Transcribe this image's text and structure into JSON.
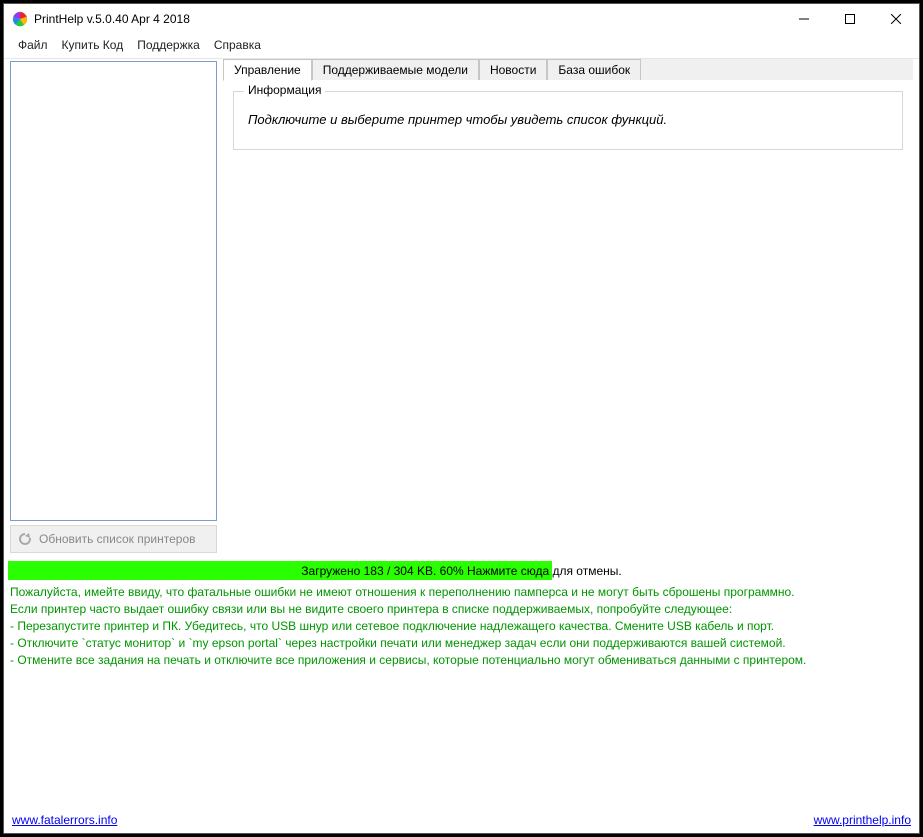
{
  "window": {
    "title": "PrintHelp v.5.0.40 Apr  4 2018"
  },
  "menu": {
    "file": "Файл",
    "buy": "Купить Код",
    "support": "Поддержка",
    "help": "Справка"
  },
  "left": {
    "refresh_label": "Обновить список принтеров"
  },
  "tabs": {
    "manage": "Управление",
    "models": "Поддерживаемые модели",
    "news": "Новости",
    "errors": "База ошибок"
  },
  "info": {
    "legend": "Информация",
    "text": "Подключите и выберите принтер чтобы увидеть список функций."
  },
  "progress": {
    "label": "Загружено 183 / 304 KB. 60% Нажмите сюда для отмены."
  },
  "log": {
    "l1": "Пожалуйста, имейте ввиду, что фатальные ошибки не имеют отношения к переполнению памперса и не могут быть сброшены программно.",
    "l2": "Если принтер часто выдает ошибку связи или вы не видите своего принтера в списке поддерживаемых, попробуйте следующее:",
    "l3": "- Перезапустите принтер и ПК. Убедитесь, что USB шнур или сетевое подключение надлежащего качества. Смените USB кабель и порт.",
    "l4": "- Отключите `статус монитор` и `my epson portal` через настройки печати или менеджер задач если они поддерживаются вашей системой.",
    "l5": "- Отмените все задания на печать и отключите все приложения и сервисы, которые потенциально могут обмениваться данными с принтером."
  },
  "footer": {
    "left_link": "www.fatalerrors.info",
    "right_link": "www.printhelp.info"
  }
}
